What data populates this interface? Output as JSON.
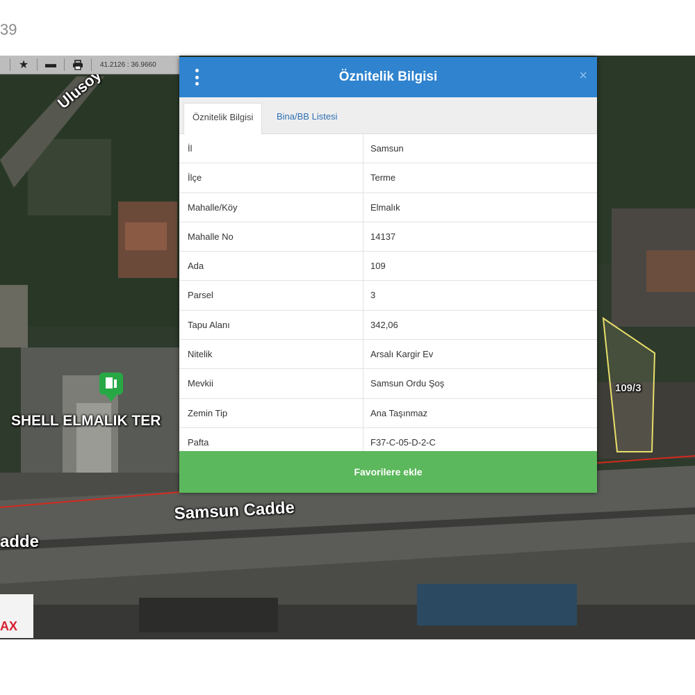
{
  "top_label": "39",
  "toolbar": {
    "coords": "41.2126 : 36.9660"
  },
  "map": {
    "labels": {
      "street_ulusoy": "Ulusoy",
      "poi_shell": "SHELL ELMALIK TER",
      "street_samsun": "Samsun Cadde",
      "street_cadde_left": "adde",
      "parcel": "109/3",
      "remax": "AX"
    },
    "colors": {
      "road_line": "#d42a1e",
      "parcel_outline": "#e8df6a"
    }
  },
  "dialog": {
    "title": "Öznitelik Bilgisi",
    "close": "×",
    "tabs": [
      {
        "label": "Öznitelik Bilgisi",
        "active": true
      },
      {
        "label": "Bina/BB Listesi",
        "active": false
      }
    ],
    "rows": [
      {
        "key": "İl",
        "value": "Samsun"
      },
      {
        "key": "İlçe",
        "value": "Terme"
      },
      {
        "key": "Mahalle/Köy",
        "value": "Elmalık"
      },
      {
        "key": "Mahalle No",
        "value": "14137"
      },
      {
        "key": "Ada",
        "value": "109"
      },
      {
        "key": "Parsel",
        "value": "3"
      },
      {
        "key": "Tapu Alanı",
        "value": "342,06"
      },
      {
        "key": "Nitelik",
        "value": "Arsalı Kargir Ev"
      },
      {
        "key": "Mevkii",
        "value": "Samsun Ordu Şoş"
      },
      {
        "key": "Zemin Tip",
        "value": "Ana Taşınmaz"
      },
      {
        "key": "Pafta",
        "value": "F37-C-05-D-2-C"
      }
    ],
    "favorite_button": "Favorilere ekle",
    "colors": {
      "header": "#2f83cf",
      "favorite": "#5cb85c"
    }
  }
}
